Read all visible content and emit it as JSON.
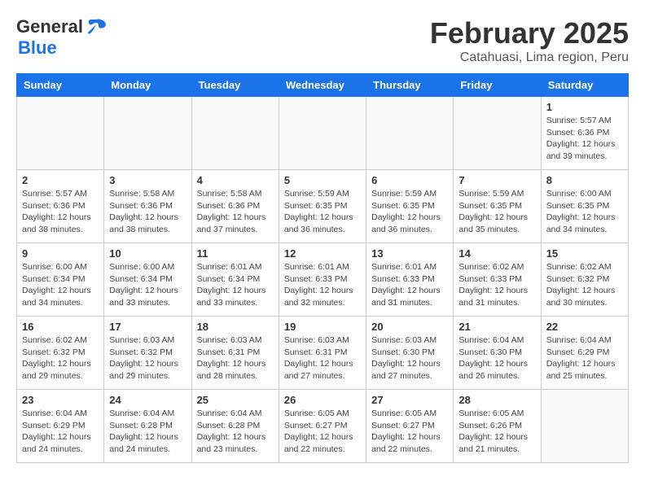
{
  "header": {
    "logo_general": "General",
    "logo_blue": "Blue",
    "month_year": "February 2025",
    "location": "Catahuasi, Lima region, Peru"
  },
  "days_of_week": [
    "Sunday",
    "Monday",
    "Tuesday",
    "Wednesday",
    "Thursday",
    "Friday",
    "Saturday"
  ],
  "weeks": [
    [
      {
        "day": "",
        "info": ""
      },
      {
        "day": "",
        "info": ""
      },
      {
        "day": "",
        "info": ""
      },
      {
        "day": "",
        "info": ""
      },
      {
        "day": "",
        "info": ""
      },
      {
        "day": "",
        "info": ""
      },
      {
        "day": "1",
        "info": "Sunrise: 5:57 AM\nSunset: 6:36 PM\nDaylight: 12 hours\nand 39 minutes."
      }
    ],
    [
      {
        "day": "2",
        "info": "Sunrise: 5:57 AM\nSunset: 6:36 PM\nDaylight: 12 hours\nand 38 minutes."
      },
      {
        "day": "3",
        "info": "Sunrise: 5:58 AM\nSunset: 6:36 PM\nDaylight: 12 hours\nand 38 minutes."
      },
      {
        "day": "4",
        "info": "Sunrise: 5:58 AM\nSunset: 6:36 PM\nDaylight: 12 hours\nand 37 minutes."
      },
      {
        "day": "5",
        "info": "Sunrise: 5:59 AM\nSunset: 6:35 PM\nDaylight: 12 hours\nand 36 minutes."
      },
      {
        "day": "6",
        "info": "Sunrise: 5:59 AM\nSunset: 6:35 PM\nDaylight: 12 hours\nand 36 minutes."
      },
      {
        "day": "7",
        "info": "Sunrise: 5:59 AM\nSunset: 6:35 PM\nDaylight: 12 hours\nand 35 minutes."
      },
      {
        "day": "8",
        "info": "Sunrise: 6:00 AM\nSunset: 6:35 PM\nDaylight: 12 hours\nand 34 minutes."
      }
    ],
    [
      {
        "day": "9",
        "info": "Sunrise: 6:00 AM\nSunset: 6:34 PM\nDaylight: 12 hours\nand 34 minutes."
      },
      {
        "day": "10",
        "info": "Sunrise: 6:00 AM\nSunset: 6:34 PM\nDaylight: 12 hours\nand 33 minutes."
      },
      {
        "day": "11",
        "info": "Sunrise: 6:01 AM\nSunset: 6:34 PM\nDaylight: 12 hours\nand 33 minutes."
      },
      {
        "day": "12",
        "info": "Sunrise: 6:01 AM\nSunset: 6:33 PM\nDaylight: 12 hours\nand 32 minutes."
      },
      {
        "day": "13",
        "info": "Sunrise: 6:01 AM\nSunset: 6:33 PM\nDaylight: 12 hours\nand 31 minutes."
      },
      {
        "day": "14",
        "info": "Sunrise: 6:02 AM\nSunset: 6:33 PM\nDaylight: 12 hours\nand 31 minutes."
      },
      {
        "day": "15",
        "info": "Sunrise: 6:02 AM\nSunset: 6:32 PM\nDaylight: 12 hours\nand 30 minutes."
      }
    ],
    [
      {
        "day": "16",
        "info": "Sunrise: 6:02 AM\nSunset: 6:32 PM\nDaylight: 12 hours\nand 29 minutes."
      },
      {
        "day": "17",
        "info": "Sunrise: 6:03 AM\nSunset: 6:32 PM\nDaylight: 12 hours\nand 29 minutes."
      },
      {
        "day": "18",
        "info": "Sunrise: 6:03 AM\nSunset: 6:31 PM\nDaylight: 12 hours\nand 28 minutes."
      },
      {
        "day": "19",
        "info": "Sunrise: 6:03 AM\nSunset: 6:31 PM\nDaylight: 12 hours\nand 27 minutes."
      },
      {
        "day": "20",
        "info": "Sunrise: 6:03 AM\nSunset: 6:30 PM\nDaylight: 12 hours\nand 27 minutes."
      },
      {
        "day": "21",
        "info": "Sunrise: 6:04 AM\nSunset: 6:30 PM\nDaylight: 12 hours\nand 26 minutes."
      },
      {
        "day": "22",
        "info": "Sunrise: 6:04 AM\nSunset: 6:29 PM\nDaylight: 12 hours\nand 25 minutes."
      }
    ],
    [
      {
        "day": "23",
        "info": "Sunrise: 6:04 AM\nSunset: 6:29 PM\nDaylight: 12 hours\nand 24 minutes."
      },
      {
        "day": "24",
        "info": "Sunrise: 6:04 AM\nSunset: 6:28 PM\nDaylight: 12 hours\nand 24 minutes."
      },
      {
        "day": "25",
        "info": "Sunrise: 6:04 AM\nSunset: 6:28 PM\nDaylight: 12 hours\nand 23 minutes."
      },
      {
        "day": "26",
        "info": "Sunrise: 6:05 AM\nSunset: 6:27 PM\nDaylight: 12 hours\nand 22 minutes."
      },
      {
        "day": "27",
        "info": "Sunrise: 6:05 AM\nSunset: 6:27 PM\nDaylight: 12 hours\nand 22 minutes."
      },
      {
        "day": "28",
        "info": "Sunrise: 6:05 AM\nSunset: 6:26 PM\nDaylight: 12 hours\nand 21 minutes."
      },
      {
        "day": "",
        "info": ""
      }
    ]
  ]
}
